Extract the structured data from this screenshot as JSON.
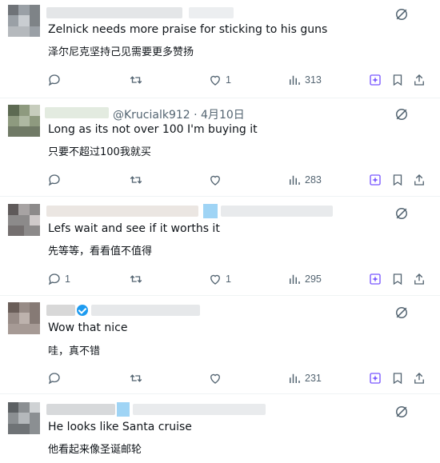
{
  "colors": {
    "icon_gray": "#536471",
    "purple": "#7856ff",
    "text": "#0f1419",
    "verified": "#1d9bf0"
  },
  "tweets": [
    {
      "handle": "",
      "text_en": "Zelnick needs more praise for sticking to his guns",
      "text_zh": "泽尔尼克坚持己见需要更多赞扬",
      "actions": {
        "reply": "",
        "retweet": "",
        "like": "1",
        "views": "313"
      }
    },
    {
      "handle": "@Krucialk912 · 4月10日",
      "text_en": "Long as its not over 100 I'm buying it",
      "text_zh": "只要不超过100我就买",
      "actions": {
        "reply": "",
        "retweet": "",
        "like": "",
        "views": "283"
      }
    },
    {
      "handle": "",
      "text_en": "Lefs wait and see if it worths it",
      "text_zh": "先等等，看看值不值得",
      "actions": {
        "reply": "1",
        "retweet": "",
        "like": "1",
        "views": "295"
      }
    },
    {
      "handle": "",
      "text_en": "Wow that nice",
      "text_zh": "哇，真不错",
      "actions": {
        "reply": "",
        "retweet": "",
        "like": "",
        "views": "231"
      }
    },
    {
      "handle": "",
      "text_en": "He looks like Santa cruise",
      "text_zh": "他看起来像圣诞邮轮",
      "actions": {}
    }
  ],
  "icons": [
    "reply-icon",
    "retweet-icon",
    "like-icon",
    "views-icon",
    "grok-icon",
    "bookmark-icon",
    "share-icon",
    "grok-explain-icon"
  ]
}
